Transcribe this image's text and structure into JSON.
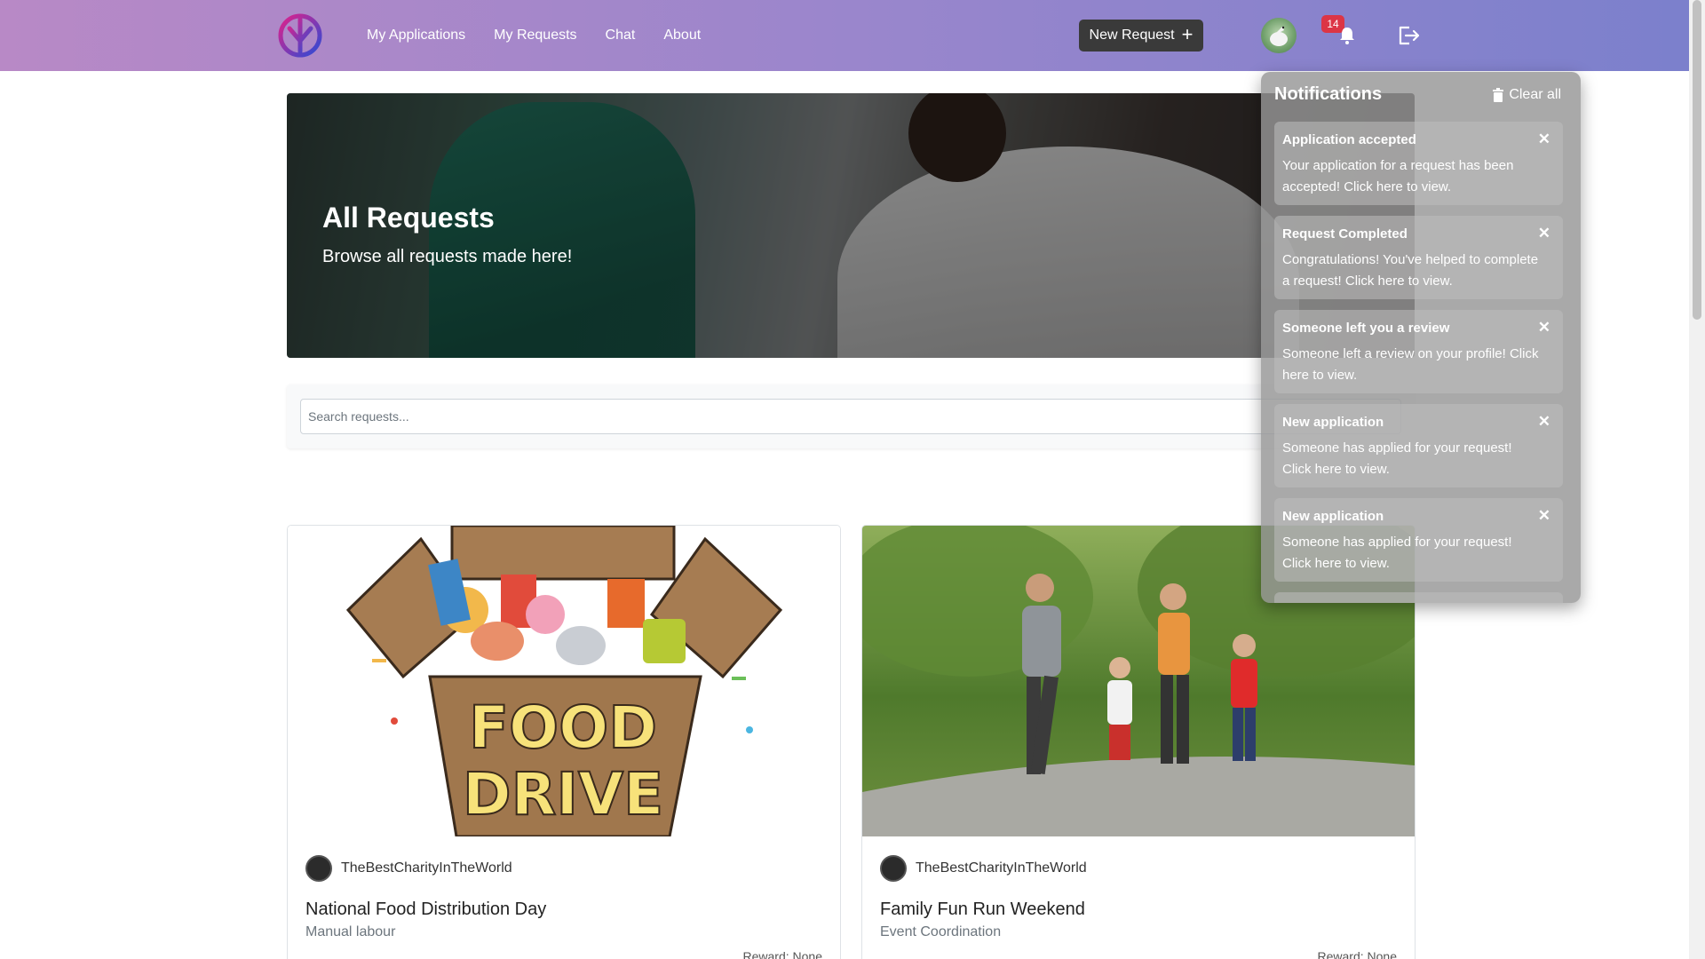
{
  "nav": {
    "logo_icon": "app-logo-icon",
    "links": [
      "My Applications",
      "My Requests",
      "Chat",
      "About"
    ],
    "new_request_label": "New Request",
    "new_request_icon": "plus-icon",
    "notification_count": "14",
    "bell_icon": "bell-icon",
    "logout_icon": "logout-icon"
  },
  "hero": {
    "title": "All Requests",
    "subtitle": "Browse all requests made here!"
  },
  "search": {
    "placeholder": "Search requests..."
  },
  "cards": [
    {
      "author": "TheBestCharityInTheWorld",
      "title": "National Food Distribution Day",
      "category": "Manual labour",
      "reward": "Reward: None",
      "image_text_line1": "FOOD",
      "image_text_line2": "DRIVE"
    },
    {
      "author": "TheBestCharityInTheWorld",
      "title": "Family Fun Run Weekend",
      "category": "Event Coordination",
      "reward": "Reward: None"
    }
  ],
  "notifications": {
    "header": "Notifications",
    "clear_all": "Clear all",
    "items": [
      {
        "title": "Application accepted",
        "body": "Your application for a request has been accepted! Click here to view."
      },
      {
        "title": "Request Completed",
        "body": "Congratulations! You've helped to complete a request! Click here to view."
      },
      {
        "title": "Someone left you a review",
        "body": "Someone left a review on your profile! Click here to view."
      },
      {
        "title": "New application",
        "body": "Someone has applied for your request! Click here to view."
      },
      {
        "title": "New application",
        "body": "Someone has applied for your request! Click here to view."
      }
    ]
  },
  "colors": {
    "nav_gradient_start": "#b889c6",
    "nav_gradient_end": "#7b80cc",
    "badge": "#dc3545",
    "button_dark": "#3a3a3a"
  }
}
